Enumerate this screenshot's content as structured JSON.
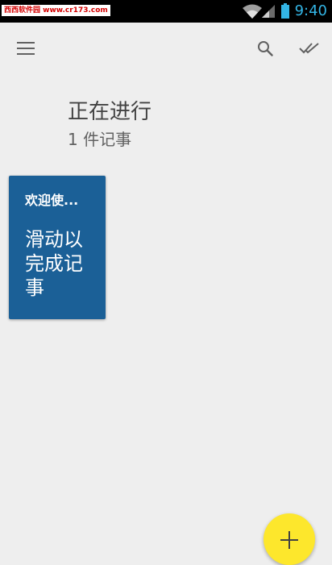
{
  "status_bar": {
    "watermark": "西西软件园 www.cr173.com",
    "time": "9:40",
    "icons": [
      "wifi-icon",
      "signal-icon",
      "battery-icon"
    ],
    "time_color": "#33b5e5"
  },
  "toolbar": {
    "menu_icon": "menu-icon",
    "search_icon": "search-icon",
    "done_icon": "done-all-icon"
  },
  "header": {
    "title": "正在进行",
    "count": "1 件记事"
  },
  "notes": [
    {
      "title": "欢迎使...",
      "body": "滑动以完成记事",
      "color": "#1b6097"
    }
  ],
  "fab": {
    "icon": "add-icon",
    "label": "+",
    "color": "#fde72c"
  },
  "colors": {
    "background": "#eeeeee",
    "status_bar": "#000000"
  }
}
